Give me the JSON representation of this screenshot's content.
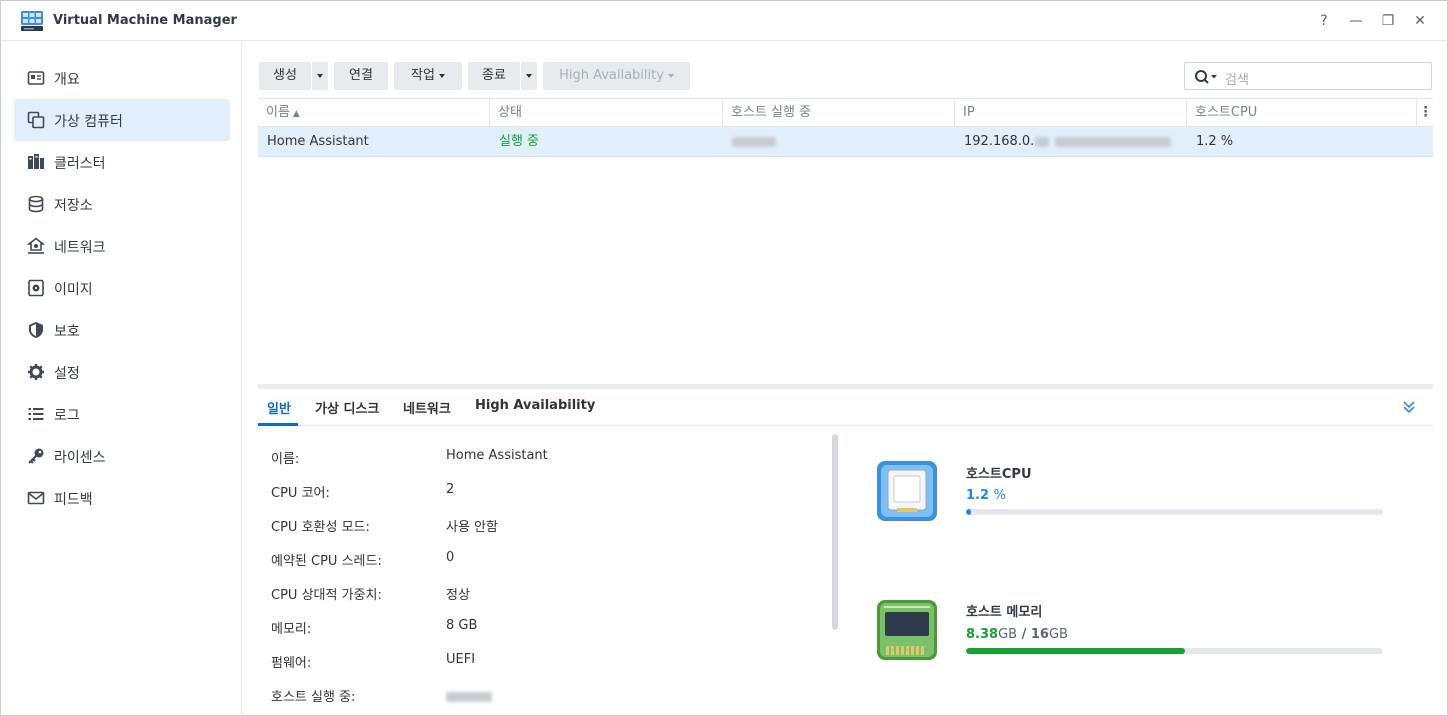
{
  "window": {
    "title": "Virtual Machine Manager",
    "buttons": [
      "?",
      "—",
      "❐",
      "✕"
    ]
  },
  "sidebar": {
    "items": [
      {
        "label": "개요",
        "icon": "overview-icon"
      },
      {
        "label": "가상 컴퓨터",
        "icon": "virtual-machine-icon",
        "active": true
      },
      {
        "label": "클러스터",
        "icon": "cluster-icon"
      },
      {
        "label": "저장소",
        "icon": "storage-icon"
      },
      {
        "label": "네트워크",
        "icon": "network-icon"
      },
      {
        "label": "이미지",
        "icon": "image-icon"
      },
      {
        "label": "보호",
        "icon": "shield-icon"
      },
      {
        "label": "설정",
        "icon": "gear-icon"
      },
      {
        "label": "로그",
        "icon": "log-icon"
      },
      {
        "label": "라이센스",
        "icon": "key-icon"
      },
      {
        "label": "피드백",
        "icon": "mail-icon"
      }
    ]
  },
  "toolbar": {
    "create": "생성",
    "connect": "연결",
    "action": "작업",
    "shutdown": "종료",
    "ha": "High Availability",
    "search_placeholder": "검색"
  },
  "grid": {
    "columns": [
      "이름",
      "상태",
      "호스트 실행 중",
      "IP",
      "호스트CPU"
    ],
    "rows": [
      {
        "name": "Home Assistant",
        "status": "실행 중",
        "ip": "192.168.0.",
        "cpu": "1.2 %"
      }
    ]
  },
  "detail": {
    "tabs": [
      "일반",
      "가상 디스크",
      "네트워크",
      "High Availability"
    ],
    "fields": [
      {
        "label": "이름:",
        "value": "Home Assistant"
      },
      {
        "label": "CPU 코어:",
        "value": "2"
      },
      {
        "label": "CPU 호환성 모드:",
        "value": "사용 안함"
      },
      {
        "label": "예약된 CPU 스레드:",
        "value": "0"
      },
      {
        "label": "CPU 상대적 가중치:",
        "value": "정상"
      },
      {
        "label": "메모리:",
        "value": "8 GB"
      },
      {
        "label": "펌웨어:",
        "value": "UEFI"
      },
      {
        "label": "호스트 실행 중:",
        "value": ""
      }
    ]
  },
  "resources": {
    "cpu": {
      "title": "호스트CPU",
      "value": "1.2",
      "unit": "%",
      "fraction": 0.012,
      "color": "#1e88e5"
    },
    "memory": {
      "title": "호스트 메모리",
      "used": "8.38",
      "used_unit": "GB",
      "sep": "/",
      "total": "16",
      "total_unit": "GB",
      "fraction": 0.524,
      "color": "#1aa034"
    }
  },
  "colors": {
    "accent": "#0f6dc7",
    "selected_row": "#e1effd",
    "status_running": "#1aa034"
  }
}
